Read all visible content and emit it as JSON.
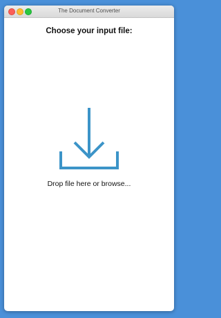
{
  "window": {
    "title": "The Document Converter"
  },
  "main": {
    "heading": "Choose your input file:",
    "drop_label": "Drop file here or browse..."
  },
  "icons": {
    "drop": "download-arrow-icon"
  },
  "colors": {
    "accent": "#3c94c8",
    "desktop": "#4a90d9"
  }
}
